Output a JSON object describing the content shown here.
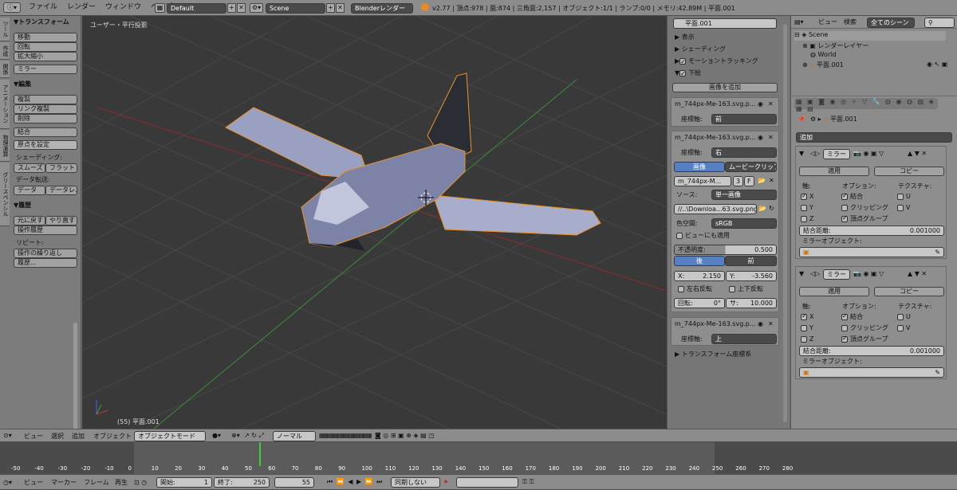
{
  "topbar": {
    "menus": [
      "ファイル",
      "レンダー",
      "ウィンドウ",
      "ヘルプ"
    ],
    "layout": "Default",
    "scene": "Scene",
    "engine": "Blenderレンダー",
    "stats": "v2.77 | 頂点:978 | 面:874 | 三角面:2,157 | オブジェクト:1/1 | ランプ:0/0 | メモリ:42.89M | 平面.001"
  },
  "toolshelf": {
    "tabs": [
      "ツール",
      "作成",
      "関係",
      "アニメーション",
      "物理演算",
      "グリースペンシル"
    ],
    "transform_title": "▼トランスフォーム",
    "move": "移動",
    "rotate": "回転",
    "scale": "拡大縮小",
    "mirror": "ミラー",
    "edit_title": "▼編集",
    "duplicate": "複製",
    "duplicate_linked": "リンク複製",
    "delete": "削除",
    "join": "結合",
    "set_origin": "原点を設定",
    "shading_label": "シェーディング:",
    "smooth": "スムーズ",
    "flat": "フラット",
    "data_transfer_label": "データ転送:",
    "data": "データ",
    "data_layout": "データレ...",
    "history_title": "▼履歴",
    "undo": "元に戻す",
    "redo": "やり直す",
    "undo_history": "操作履歴",
    "repeat_label": "リピート:",
    "repeat_last": "操作の繰り返し",
    "history": "履歴..."
  },
  "viewport": {
    "label": "ユーザー・平行投影",
    "object_label": "(55) 平面.001"
  },
  "properties": {
    "object_name": "平面.001",
    "display": "表示",
    "shading": "シェーディング",
    "motion_tracking": "モーショントラッキング",
    "background": "下絵",
    "add_image": "画像を追加",
    "bg1_name": "m_744px-Me-163.svg.p...",
    "axis_label": "座標軸:",
    "bg1_axis": "前",
    "bg2_name": "m_744px-Me-163.svg.p...",
    "bg2_axis": "右",
    "image_tab": "画像",
    "movie_tab": "ムービークリップ",
    "image_field": "m_744px-M...",
    "users": "3",
    "fake": "F",
    "source_label": "ソース:",
    "source": "単一画像",
    "filepath": "//..\\Downloa...63.svg.png",
    "colorspace_label": "色空間:",
    "colorspace": "sRGB",
    "view_too": "ビューにも適用",
    "opacity_label": "不透明度:",
    "opacity": "0.500",
    "back": "後",
    "front": "前",
    "x_label": "X:",
    "x_val": "2.150",
    "y_label": "Y:",
    "y_val": "-3.560",
    "flip_x": "左右反転",
    "flip_y": "上下反転",
    "rot_label": "回転:",
    "rot_val": "0°",
    "size_label": "サ:",
    "size_val": "10.000",
    "bg3_name": "m_744px-Me-163.svg.p...",
    "bg3_axis": "上",
    "transform_orient": "トランスフォーム座標系"
  },
  "outliner": {
    "view": "ビュー",
    "search": "検索",
    "filter": "全てのシーン",
    "scene": "Scene",
    "render_layers": "レンダーレイヤー",
    "world": "World",
    "object": "平面.001"
  },
  "modifiers": {
    "crumb": "平面.001",
    "add": "追加",
    "mods": [
      {
        "name": "ミラー",
        "apply": "適用",
        "copy": "コピー",
        "axis": "軸:",
        "options": "オプション:",
        "texture": "テクスチャ:",
        "x": "X",
        "y": "Y",
        "z": "Z",
        "merge": "結合",
        "clipping": "クリッピング",
        "vgroups": "頂点グループ",
        "u": "U",
        "v": "V",
        "merge_limit": "結合距離:",
        "merge_val": "0.001000",
        "mirror_obj": "ミラーオブジェクト:"
      },
      {
        "name": "ミラー",
        "apply": "適用",
        "copy": "コピー",
        "axis": "軸:",
        "options": "オプション:",
        "texture": "テクスチャ:",
        "x": "X",
        "y": "Y",
        "z": "Z",
        "merge": "結合",
        "clipping": "クリッピング",
        "vgroups": "頂点グループ",
        "u": "U",
        "v": "V",
        "merge_limit": "結合距離:",
        "merge_val": "0.001000",
        "mirror_obj": "ミラーオブジェクト:"
      }
    ]
  },
  "view3d_header": {
    "view": "ビュー",
    "select": "選択",
    "add": "追加",
    "object": "オブジェクト",
    "mode": "オブジェクトモード",
    "pivot": "ノーマル"
  },
  "timeline": {
    "ticks": [
      "-50",
      "-40",
      "-30",
      "-20",
      "-10",
      "0",
      "10",
      "20",
      "30",
      "40",
      "50",
      "60",
      "70",
      "80",
      "90",
      "100",
      "110",
      "120",
      "130",
      "140",
      "150",
      "160",
      "170",
      "180",
      "190",
      "200",
      "210",
      "220",
      "230",
      "240",
      "250",
      "260",
      "270",
      "280"
    ],
    "current": 55
  },
  "timeline_header": {
    "view": "ビュー",
    "marker": "マーカー",
    "frame": "フレーム",
    "playback": "再生",
    "start_label": "開始:",
    "start": "1",
    "end_label": "終了:",
    "end": "250",
    "current": "55",
    "sync": "同期しない"
  },
  "colors": {
    "viewport": "#393939",
    "accent": "#5680c2",
    "grid_x": "#8b2b2b",
    "grid_y": "#3d8b3d"
  }
}
